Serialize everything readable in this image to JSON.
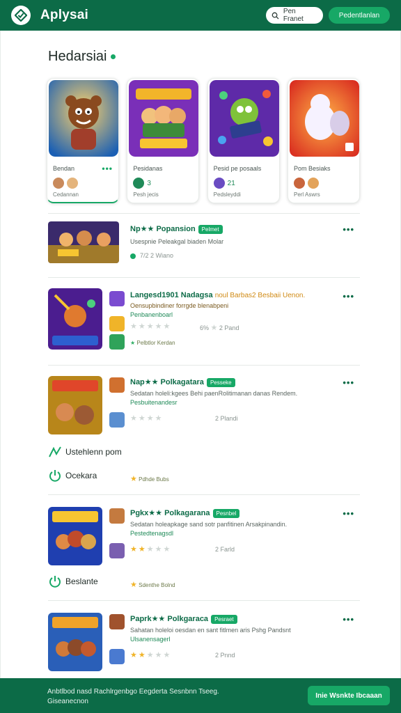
{
  "header": {
    "app_title": "Aplysai",
    "search_label": "Pen Franet",
    "cta_label": "Pedentlanlan",
    "colors": {
      "bar": "#0c6b47",
      "accent": "#17a866"
    }
  },
  "featured": {
    "title": "Hedarsiai",
    "cards": [
      {
        "name": "Bendan",
        "meta": "",
        "sub": "Cedannan",
        "art": "bear-hero"
      },
      {
        "name": "Pesidanas",
        "meta": "3",
        "sub": "Pesh jecis",
        "art": "manias"
      },
      {
        "name": "Pesid pe posaals",
        "meta": "21",
        "sub": "Pedsleyddi",
        "art": "green-monster"
      },
      {
        "name": "Pom Besiaks",
        "meta": "",
        "sub": "Perl Aswrs",
        "art": "white-cat"
      }
    ]
  },
  "rows": [
    {
      "title": "Np★★ Popansion",
      "badge": "Pelmet",
      "desc": "Usespnie Peleakgal biaden Molar",
      "sub": "",
      "rating_text": "7/2 2 Wiano",
      "rating_left": ""
    },
    {
      "title": "Langesd1901 Nadagsa",
      "badge": "",
      "title_extra": "noul Barbas2 Besbaii Uenon.",
      "desc": "Oensupbindiner forrgde blenabpeni",
      "sub": "Penbanenboarl",
      "rating_left": "6%",
      "rating_text": "2 Pand",
      "tag": "Pelbtlor Kerdan"
    },
    {
      "title": "Nap★★ Polkagatara",
      "badge": "Pesseke",
      "desc": "Sedatan holeli:kgees Behi paenRolitimanan danas Rendem.",
      "sub": "Pesbuitenandesr",
      "rating_text": "2 Plandi",
      "rating_left": ""
    },
    {
      "title": "Pgkx★★ Polkagarana",
      "badge": "Pesnbel",
      "desc": "Sedatan holeapkage sand sotr panfitinen Arsakpinandin.",
      "sub": "Pestedtenagsdl",
      "rating_text": "2 Farld",
      "rating_left": ""
    },
    {
      "title": "Paprk★★ Polkgaraca",
      "badge": "Pesraet",
      "desc": "Sahatan holeloi oesdan en sant fitlmen aris Pshg Pandsnt",
      "sub": "Ulsanensagerl",
      "rating_text": "2 Pnnd",
      "rating_left": ""
    }
  ],
  "aside_items": [
    {
      "label": "Ustehlenn pom",
      "tag": ""
    },
    {
      "label": "Ocekara",
      "tag": "Pdhde Bubs"
    },
    {
      "label": "Beslante",
      "tag": "Sdenthe Bolnd"
    }
  ],
  "footer": {
    "text_line1": "Anbtlbod nasd Rachlrgenbgo Eegderta Sesnbnn Tseeg.",
    "text_line2": "Giseanecnon",
    "button_label": "Inie Wsnkte Ibcaaan"
  }
}
